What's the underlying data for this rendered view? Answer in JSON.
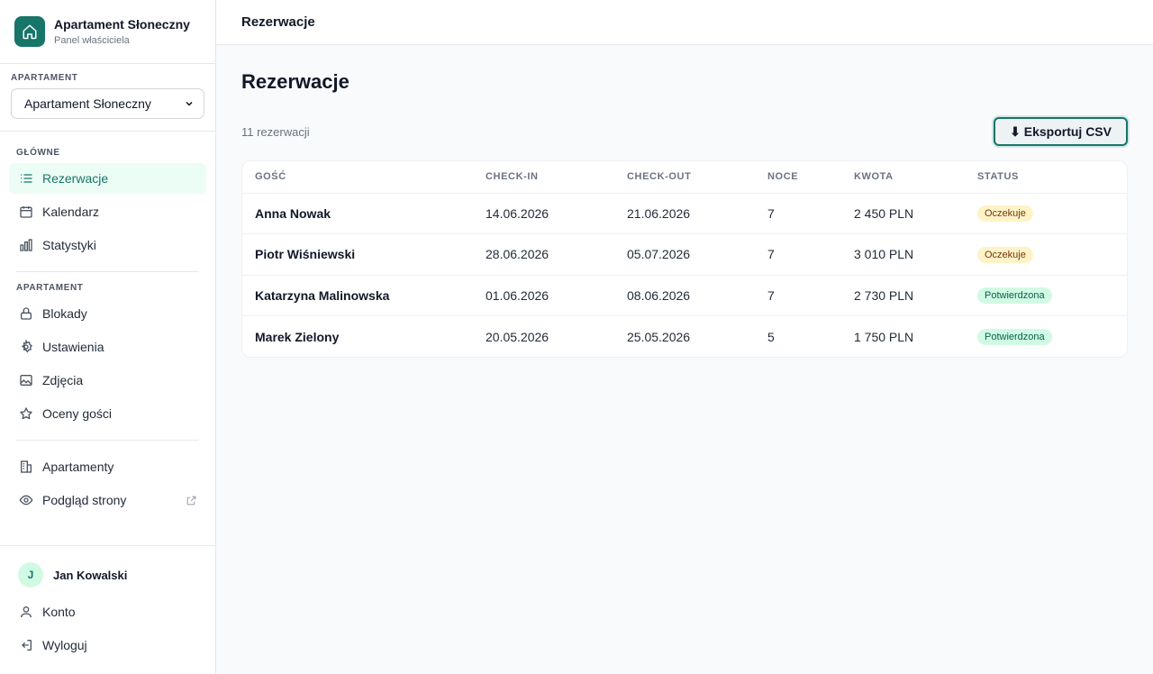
{
  "brand": {
    "title": "Apartament Słoneczny",
    "subtitle": "Panel właściciela",
    "icon": "home-icon",
    "color": "#17756a"
  },
  "apartment_selector": {
    "label": "APARTAMENT",
    "selected": "Apartament Słoneczny"
  },
  "nav": {
    "main_label": "GŁÓWNE",
    "main_items": [
      {
        "label": "Rezerwacje",
        "icon": "list-icon",
        "active": true
      },
      {
        "label": "Kalendarz",
        "icon": "calendar-icon"
      },
      {
        "label": "Statystyki",
        "icon": "bar-chart-icon"
      }
    ],
    "apartment_label": "APARTAMENT",
    "apartment_items": [
      {
        "label": "Blokady",
        "icon": "lock-icon"
      },
      {
        "label": "Ustawienia",
        "icon": "gear-icon"
      },
      {
        "label": "Zdjęcia",
        "icon": "image-icon"
      },
      {
        "label": "Oceny gości",
        "icon": "star-icon"
      }
    ],
    "other_items": [
      {
        "label": "Apartamenty",
        "icon": "building-icon"
      },
      {
        "label": "Podgląd strony",
        "icon": "eye-icon"
      }
    ]
  },
  "user": {
    "initial": "J",
    "name": "Jan Kowalski",
    "account_label": "Konto",
    "logout_label": "Wyloguj"
  },
  "topbar": {
    "title": "Rezerwacje"
  },
  "page": {
    "title": "Rezerwacje",
    "count": "11 rezerwacji",
    "export_label": "⬇ Eksportuj CSV"
  },
  "table": {
    "headers": [
      "GOŚĆ",
      "CHECK-IN",
      "CHECK-OUT",
      "NOCE",
      "KWOTA",
      "STATUS"
    ],
    "rows": [
      {
        "guest": "Anna Nowak",
        "checkin": "14.06.2026",
        "checkout": "21.06.2026",
        "nights": "7",
        "amount": "2 450 PLN",
        "status": "Oczekuje"
      },
      {
        "guest": "Piotr Wiśniewski",
        "checkin": "28.06.2026",
        "checkout": "05.07.2026",
        "nights": "7",
        "amount": "3 010 PLN",
        "status": "Oczekuje"
      },
      {
        "guest": "Katarzyna Malinowska",
        "checkin": "01.06.2026",
        "checkout": "08.06.2026",
        "nights": "7",
        "amount": "2 730 PLN",
        "status": "Potwierdzona"
      },
      {
        "guest": "Marek Zielony",
        "checkin": "20.05.2026",
        "checkout": "25.05.2026",
        "nights": "5",
        "amount": "1 750 PLN",
        "status": "Potwierdzona"
      }
    ]
  },
  "colors": {
    "accent": "#17756a",
    "pending_bg": "#fef3c7",
    "confirmed_bg": "#d1fae5"
  }
}
